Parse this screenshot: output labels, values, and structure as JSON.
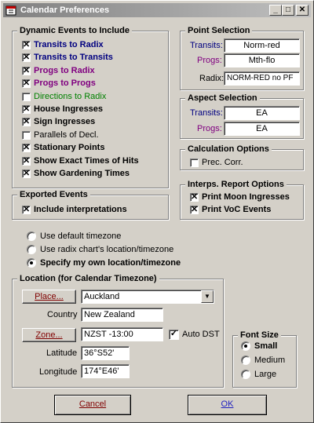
{
  "window": {
    "title": "Calendar Preferences",
    "controls": {
      "minimize": "_",
      "maximize": "□",
      "close": "✕"
    }
  },
  "dynamic_events": {
    "title": "Dynamic Events to Include",
    "items": [
      {
        "label": "Transits to Radix",
        "checked": true,
        "color": "#000080",
        "bold": true
      },
      {
        "label": "Transits to Transits",
        "checked": true,
        "color": "#000080",
        "bold": true
      },
      {
        "label": "Progs to Radix",
        "checked": true,
        "color": "#800080",
        "bold": true
      },
      {
        "label": "Progs to Progs",
        "checked": true,
        "color": "#800080",
        "bold": true
      },
      {
        "label": "Directions to Radix",
        "checked": false,
        "color": "#008000",
        "bold": false
      },
      {
        "label": "House Ingresses",
        "checked": true,
        "color": "#000000",
        "bold": true
      },
      {
        "label": "Sign Ingresses",
        "checked": true,
        "color": "#000000",
        "bold": true
      },
      {
        "label": "Parallels of Decl.",
        "checked": false,
        "color": "#000000",
        "bold": false
      },
      {
        "label": "Stationary Points",
        "checked": true,
        "color": "#000000",
        "bold": true
      },
      {
        "label": "Show Exact Times of Hits",
        "checked": true,
        "color": "#000000",
        "bold": true
      },
      {
        "label": "Show Gardening Times",
        "checked": true,
        "color": "#000000",
        "bold": true
      }
    ]
  },
  "exported_events": {
    "title": "Exported Events",
    "include_interpretations": {
      "label": "Include interpretations",
      "checked": true
    }
  },
  "point_selection": {
    "title": "Point Selection",
    "transits": {
      "label": "Transits:",
      "value": "Norm-red"
    },
    "progs": {
      "label": "Progs:",
      "value": "Mth-flo"
    },
    "radix": {
      "label": "Radix:",
      "value": "NORM-RED no PF"
    }
  },
  "aspect_selection": {
    "title": "Aspect Selection",
    "transits": {
      "label": "Transits:",
      "value": "EA"
    },
    "progs": {
      "label": "Progs:",
      "value": "EA"
    }
  },
  "calculation_options": {
    "title": "Calculation Options",
    "prec_corr": {
      "label": "Prec. Corr.",
      "checked": false
    }
  },
  "interps_options": {
    "title": "Interps. Report Options",
    "moon_ingresses": {
      "label": "Print Moon Ingresses",
      "checked": true
    },
    "voc_events": {
      "label": "Print VoC Events",
      "checked": true
    }
  },
  "timezone_choice": {
    "options": [
      {
        "label": "Use default timezone",
        "selected": false
      },
      {
        "label": "Use radix chart's location/timezone",
        "selected": false
      },
      {
        "label": "Specify my own location/timezone",
        "selected": true
      }
    ]
  },
  "location": {
    "title": "Location (for Calendar Timezone)",
    "place_button": "Place...",
    "place_value": "Auckland",
    "country_label": "Country",
    "country_value": "New Zealand",
    "zone_button": "Zone...",
    "zone_value": "NZST -13:00",
    "auto_dst": {
      "label": "Auto DST",
      "checked": true
    },
    "latitude_label": "Latitude",
    "latitude_value": "36°S52'",
    "longitude_label": "Longitude",
    "longitude_value": "174°E46'"
  },
  "font_size": {
    "title": "Font Size",
    "options": [
      {
        "label": "Small",
        "selected": true
      },
      {
        "label": "Medium",
        "selected": false
      },
      {
        "label": "Large",
        "selected": false
      }
    ]
  },
  "buttons": {
    "cancel": "Cancel",
    "ok": "OK"
  }
}
